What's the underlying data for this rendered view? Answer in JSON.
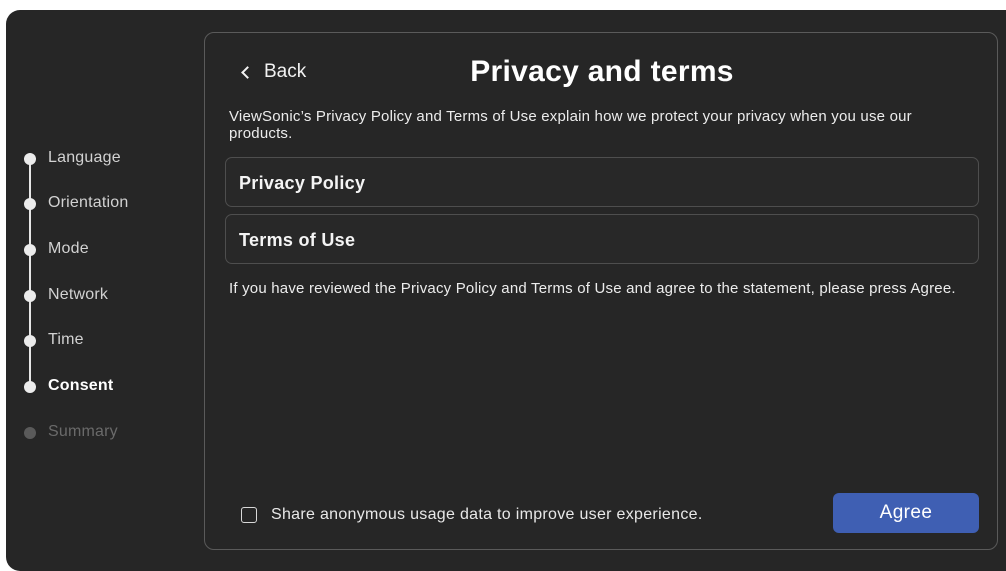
{
  "sidebar": {
    "steps": [
      {
        "label": "Language",
        "state": "done"
      },
      {
        "label": "Orientation",
        "state": "done"
      },
      {
        "label": "Mode",
        "state": "done"
      },
      {
        "label": "Network",
        "state": "done"
      },
      {
        "label": "Time",
        "state": "done"
      },
      {
        "label": "Consent",
        "state": "active"
      },
      {
        "label": "Summary",
        "state": "pending"
      }
    ]
  },
  "header": {
    "back_label": "Back",
    "title": "Privacy and terms"
  },
  "main": {
    "intro": "ViewSonic’s Privacy Policy and Terms of Use explain how we protect your privacy when you use our products.",
    "links": [
      {
        "label": "Privacy Policy"
      },
      {
        "label": "Terms of Use"
      }
    ],
    "notice": "If you have reviewed the Privacy Policy and Terms of Use and agree to the statement, please press Agree."
  },
  "footer": {
    "share_label": "Share anonymous usage data to improve user experience.",
    "share_checked": false,
    "agree_label": "Agree"
  },
  "colors": {
    "background": "#262626",
    "accent": "#3f5fb3",
    "text": "#ffffff",
    "border": "#5a5a5a"
  },
  "icons": {
    "back": "chevron-left-icon",
    "step_marker": "dot-icon",
    "checkbox": "checkbox-unchecked-icon"
  }
}
